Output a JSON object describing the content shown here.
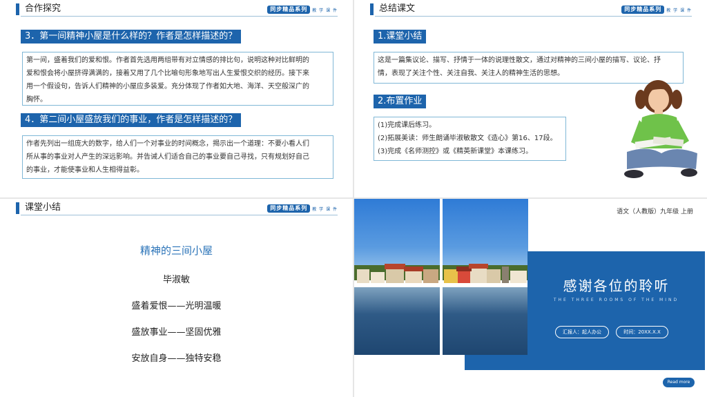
{
  "slide1": {
    "title": "合作探究",
    "brand": "同步精品系列",
    "brand_sub": "教 学 课 件",
    "q3_label": "3．第一间精神小屋是什么样的？作者是怎样描述的？",
    "q3_lines": [
      "第一间，盛着我们的爱和恨。作者首先选用两组带有对立情感的排比句，说明这种对比鲜明的",
      "爱和恨会将小屋挤得满满的，接着又用了几个比喻句形象地写出人生爱恨交织的经历。接下来",
      "用一个假设句，告诉人们精神的小屋应多装爱。充分体现了作者如大地、海洋、天空般深广的",
      "胸怀。"
    ],
    "q4_label": "4．第二间小屋盛放我们的事业，作者是怎样描述的？",
    "q4_lines": [
      "作者先列出一组庞大的数字，给人们一个对事业的时间概念，揭示出一个道理：不要小看人们",
      "所从事的事业对人产生的深远影响。并告诫人们适合自己的事业要自己寻找，只有规划好自己",
      "的事业，才能使事业和人生相得益彰。"
    ]
  },
  "slide2": {
    "title": "总结课文",
    "brand": "同步精品系列",
    "brand_sub": "教 学 课 件",
    "sec1_label": "1.课堂小结",
    "sec1_lines": [
      "这是一篇集议论、描写、抒情于一体的说理性散文，通过对精神的三间小屋的描写、议论、抒",
      "情，表现了关注个性、关注自我、关注人的精神生活的思想。"
    ],
    "sec2_label": "2.布置作业",
    "sec2_lines": [
      "(1)完成课后练习。",
      "(2)拓展美读：师生朗诵毕淑敏散文《造心》第16、17段。",
      "(3)完成《名师测控》或《精英新课堂》本课练习。"
    ]
  },
  "slide3": {
    "title": "课堂小结",
    "brand": "同步精品系列",
    "brand_sub": "教 学 课 件",
    "heading": "精神的三间小屋",
    "author": "毕淑敏",
    "points": [
      "盛着爱恨——光明温暖",
      "盛放事业——坚固优雅",
      "安放自身——独特安稳"
    ]
  },
  "slide4": {
    "course": "语文（人教版）九年级 上册",
    "thanks": "感谢各位的聆听",
    "subtitle": "THE THREE ROOMS OF THE MIND",
    "reporter": "汇报人：起人办公",
    "time": "时间：20XX.X.X",
    "read_more": "Read more"
  },
  "colors": {
    "accent": "#1d64ac",
    "border": "#7fb7d6",
    "heading_text": "#2a73b8"
  }
}
